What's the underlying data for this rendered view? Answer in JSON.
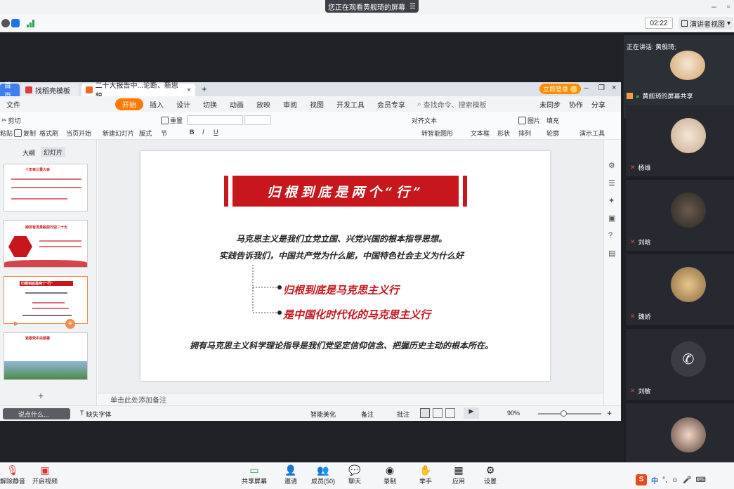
{
  "meeting": {
    "viewing_banner": "您正在观看黄舰琦的屏幕",
    "timer": "02:22",
    "presenter_view": "演讲者视图",
    "speaking_label": "正在讲话: 黄舰琦;",
    "sharing_label": "黄舰琦的屏幕共享"
  },
  "wps": {
    "tabs": [
      {
        "label": "首页"
      },
      {
        "label": "找稻壳模板"
      },
      {
        "label": "二十大报告中...论断、新思想"
      }
    ],
    "login_button": "立即登录",
    "menus": [
      "文件",
      "开始",
      "插入",
      "设计",
      "切换",
      "动画",
      "放映",
      "审阅",
      "视图",
      "开发工具",
      "会员专享"
    ],
    "search_placeholder": "查找命令、搜索模板",
    "sync_labels": [
      "未同步",
      "协作",
      "分享"
    ],
    "ribbon": {
      "cut": "剪切",
      "paste": "粘贴",
      "copy": "复制",
      "format_painter": "格式刷",
      "from_current": "当页开始",
      "new_slide": "新建幻灯片",
      "layout": "版式",
      "section": "节",
      "reset": "重置",
      "align_text": "对齐文本",
      "smart_art": "转智能图形",
      "text_box": "文本框",
      "shape": "形状",
      "arrange": "排列",
      "picture": "图片",
      "fill": "填充",
      "outline": "轮廓",
      "present_tools": "演示工具"
    },
    "panel_tabs": [
      "大纲",
      "幻灯片"
    ],
    "notes_placeholder": "单击此处添加备注",
    "status": {
      "missing_font": "缺失字体",
      "smart_beautify": "智能美化",
      "notes": "备注",
      "comments": "批注",
      "zoom": "90%"
    }
  },
  "slide": {
    "title": "归根到底是两个“行”",
    "line1": "马克思主义是我们立党立国、兴党兴国的根本指导思想。",
    "line2": "实践告诉我们，中国共产党为什么能，中国特色社会主义为什么好",
    "bullet1": "归根到底是马克思主义行",
    "bullet2": "是中国化时代化的马克思主义行",
    "conclusion": "拥有马克思主义科学理论指导是我们党坚定信仰信念、把握历史主动的根本所在。",
    "thumb_titles": [
      "十年来三重大会",
      "踔厉奋发勇毅前行迎二十大",
      "归根到底是两个“行”",
      "紧跟党中央部署"
    ]
  },
  "participants": [
    {
      "name": "杨维"
    },
    {
      "name": "刘晗"
    },
    {
      "name": "魏娇"
    },
    {
      "name": "刘敏"
    }
  ],
  "bottom": {
    "mute": "解除静音",
    "video": "开启视频",
    "share": "共享屏幕",
    "invite": "邀请",
    "members": "成员(50)",
    "chat": "聊天",
    "record": "录制",
    "raise_hand": "举手",
    "apps": "应用",
    "settings": "设置",
    "ime_lang": "中"
  },
  "chat_hint": "说点什么..."
}
